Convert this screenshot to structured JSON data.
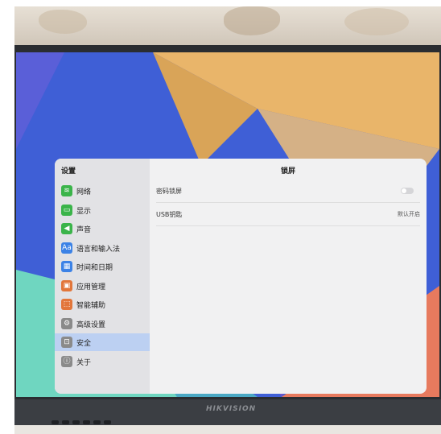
{
  "settings": {
    "sidebar_title": "设置",
    "items": [
      {
        "label": "网络",
        "icon": "wifi-icon",
        "glyph": "≋",
        "color": "#3bb44a"
      },
      {
        "label": "显示",
        "icon": "display-icon",
        "glyph": "▭",
        "color": "#3bb44a"
      },
      {
        "label": "声音",
        "icon": "speaker-icon",
        "glyph": "◀",
        "color": "#3bb44a"
      },
      {
        "label": "语言和输入法",
        "icon": "language-icon",
        "glyph": "Aa",
        "color": "#3c82e6"
      },
      {
        "label": "时间和日期",
        "icon": "calendar-icon",
        "glyph": "▦",
        "color": "#3c82e6"
      },
      {
        "label": "应用管理",
        "icon": "apps-icon",
        "glyph": "▣",
        "color": "#e2763a"
      },
      {
        "label": "智能辅助",
        "icon": "assist-icon",
        "glyph": "⬚",
        "color": "#e2763a"
      },
      {
        "label": "高级设置",
        "icon": "gear-icon",
        "glyph": "⚙",
        "color": "#8a8a8a"
      },
      {
        "label": "安全",
        "icon": "lock-icon",
        "glyph": "⊡",
        "color": "#8a8a8a"
      },
      {
        "label": "关于",
        "icon": "info-icon",
        "glyph": "ⓘ",
        "color": "#8a8a8a"
      }
    ],
    "active_item": "安全"
  },
  "content": {
    "title": "锁屏",
    "rows": [
      {
        "label": "密码锁屏",
        "toggle": false
      },
      {
        "label": "USB钥匙",
        "value": "默认开启"
      }
    ]
  },
  "device": {
    "brand": "HIKVISION"
  },
  "colors": {
    "wallpaper_blue": "#3f5fd6",
    "wallpaper_orange": "#e8b060",
    "wallpaper_teal": "#6fd6c0",
    "wallpaper_red": "#e77a5e",
    "sidebar_active": "#bcd0f2"
  }
}
